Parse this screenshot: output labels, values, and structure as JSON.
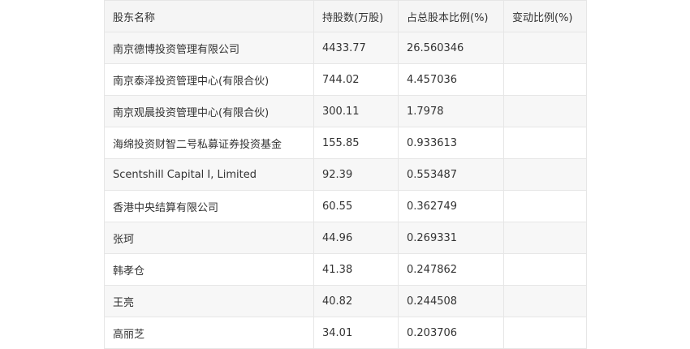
{
  "table": {
    "headers": [
      "股东名称",
      "持股数(万股)",
      "占总股本比例(%)",
      "变动比例(%)"
    ],
    "rows": [
      [
        "南京德博投资管理有限公司",
        "4433.77",
        "26.560346",
        ""
      ],
      [
        "南京泰泽投资管理中心(有限合伙)",
        "744.02",
        "4.457036",
        ""
      ],
      [
        "南京观晨投资管理中心(有限合伙)",
        "300.11",
        "1.7978",
        ""
      ],
      [
        "海绵投资财智二号私募证券投资基金",
        "155.85",
        "0.933613",
        ""
      ],
      [
        "Scentshill Capital I, Limited",
        "92.39",
        "0.553487",
        ""
      ],
      [
        "香港中央结算有限公司",
        "60.55",
        "0.362749",
        ""
      ],
      [
        "张珂",
        "44.96",
        "0.269331",
        ""
      ],
      [
        "韩孝仓",
        "41.38",
        "0.247862",
        ""
      ],
      [
        "王亮",
        "40.82",
        "0.244508",
        ""
      ],
      [
        "高丽芝",
        "34.01",
        "0.203706",
        ""
      ]
    ]
  }
}
